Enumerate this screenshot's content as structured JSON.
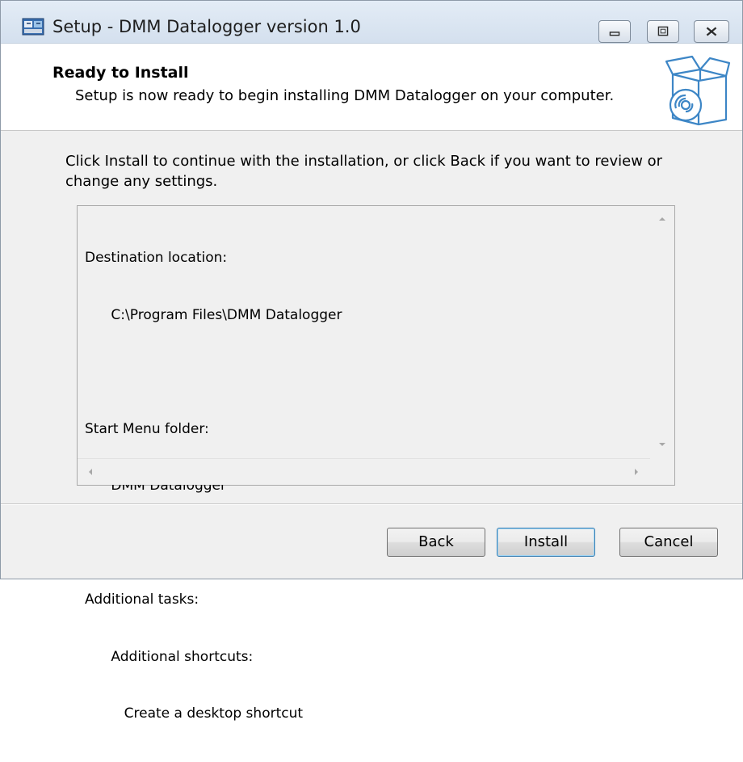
{
  "window": {
    "title": "Setup - DMM Datalogger version 1.0",
    "icon": "setup-app-icon",
    "caption_buttons": [
      "minimize",
      "maximize",
      "close"
    ]
  },
  "header": {
    "title": "Ready to Install",
    "subtitle": "Setup is now ready to begin installing DMM Datalogger on your computer.",
    "icon": "software-box-disc-icon"
  },
  "instructions": "Click Install to continue with the installation, or click Back if you want to review or change any settings.",
  "memo": {
    "lines": [
      "Destination location:",
      "      C:\\Program Files\\DMM Datalogger",
      "",
      "Start Menu folder:",
      "      DMM Datalogger",
      "",
      "Additional tasks:",
      "      Additional shortcuts:",
      "         Create a desktop shortcut"
    ]
  },
  "buttons": {
    "back": "Back",
    "install": "Install",
    "cancel": "Cancel"
  },
  "colors": {
    "window_bg": "#f0f0f0",
    "header_bg": "#ffffff",
    "default_button_border": "#3c7fb1",
    "titlebar": "#dbe6f2"
  }
}
